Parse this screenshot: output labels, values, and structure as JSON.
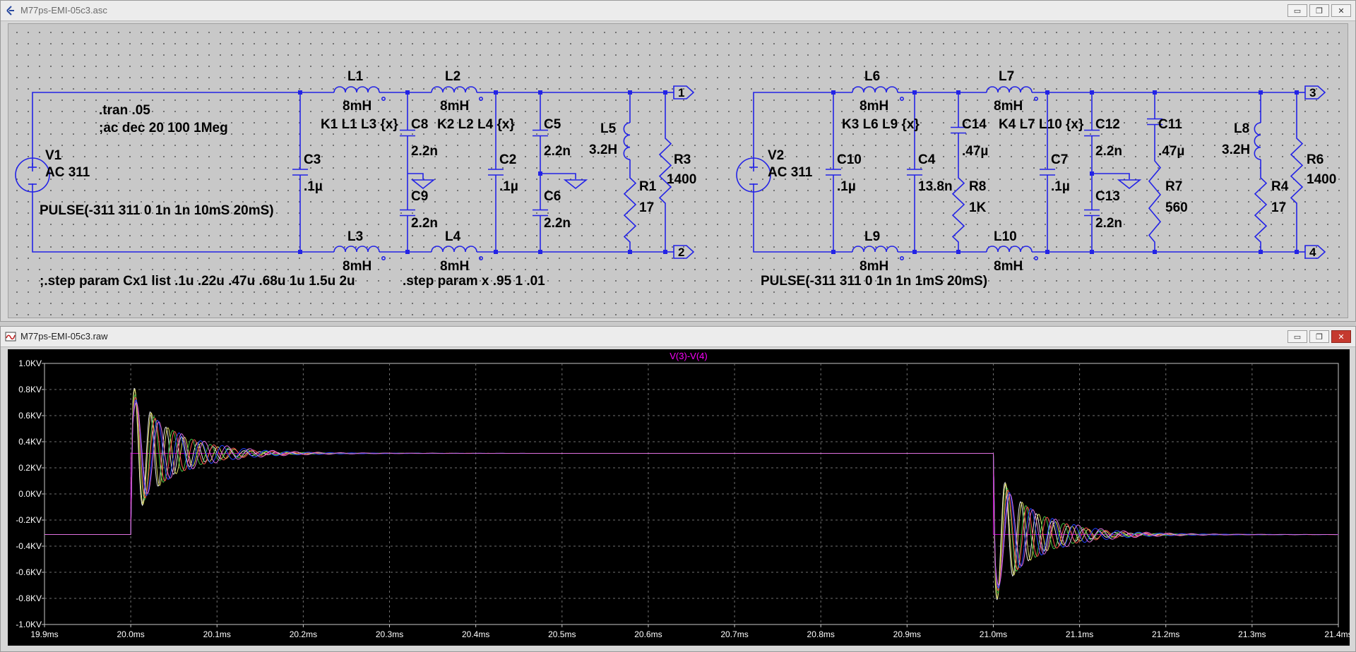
{
  "schematic_window": {
    "title": "M77ps-EMI-05c3.asc",
    "buttons": {
      "minimize": "▭",
      "restore": "❐",
      "close": "✕"
    }
  },
  "plot_window": {
    "title": "M77ps-EMI-05c3.raw",
    "buttons": {
      "minimize": "▭",
      "restore": "❐",
      "close": "✕"
    }
  },
  "schematic": {
    "directives": {
      "tran": ".tran .05",
      "ac": ";ac dec 20 100 1Meg",
      "step1": ";.step param Cx1 list .1u .22u .47u .68u 1u 1.5u 2u",
      "step2": ".step param x .95 1 .01",
      "pulse1": "PULSE(-311 311 0 1n 1n 10mS 20mS)",
      "pulse2": "PULSE(-311 311 0 1n 1n 1mS 20mS)"
    },
    "sources": {
      "v1": {
        "name": "V1",
        "value": "AC 311"
      },
      "v2": {
        "name": "V2",
        "value": "AC 311"
      }
    },
    "inductors": {
      "l1": {
        "name": "L1",
        "value": "8mH"
      },
      "l2": {
        "name": "L2",
        "value": "8mH"
      },
      "l3": {
        "name": "L3",
        "value": "8mH"
      },
      "l4": {
        "name": "L4",
        "value": "8mH"
      },
      "l5": {
        "name": "L5",
        "value": "3.2H"
      },
      "l6": {
        "name": "L6",
        "value": "8mH"
      },
      "l7": {
        "name": "L7",
        "value": "8mH"
      },
      "l8": {
        "name": "L8",
        "value": "3.2H"
      },
      "l9": {
        "name": "L9",
        "value": "8mH"
      },
      "l10": {
        "name": "L10",
        "value": "8mH"
      }
    },
    "couplings": {
      "k1": "K1 L1 L3 {x}",
      "k2": "K2 L2 L4 {x}",
      "k3": "K3 L6 L9 {x}",
      "k4": "K4 L7 L10 {x}"
    },
    "capacitors": {
      "c2": {
        "name": "C2",
        "value": ".1µ"
      },
      "c3": {
        "name": "C3",
        "value": ".1µ"
      },
      "c4": {
        "name": "C4",
        "value": "13.8n"
      },
      "c5": {
        "name": "C5",
        "value": "2.2n"
      },
      "c6": {
        "name": "C6",
        "value": "2.2n"
      },
      "c7": {
        "name": "C7",
        "value": ".1µ"
      },
      "c8": {
        "name": "C8",
        "value": "2.2n"
      },
      "c9": {
        "name": "C9",
        "value": "2.2n"
      },
      "c10": {
        "name": "C10",
        "value": ".1µ"
      },
      "c11": {
        "name": "C11",
        "value": ".47µ"
      },
      "c12": {
        "name": "C12",
        "value": "2.2n"
      },
      "c13": {
        "name": "C13",
        "value": "2.2n"
      },
      "c14": {
        "name": "C14",
        "value": ".47µ"
      }
    },
    "resistors": {
      "r1": {
        "name": "R1",
        "value": "17"
      },
      "r3": {
        "name": "R3",
        "value": "1400"
      },
      "r4": {
        "name": "R4",
        "value": "17"
      },
      "r6": {
        "name": "R6",
        "value": "1400"
      },
      "r7": {
        "name": "R7",
        "value": "560"
      },
      "r8": {
        "name": "R8",
        "value": "1K"
      }
    },
    "ports": {
      "p1": "1",
      "p2": "2",
      "p3": "3",
      "p4": "4"
    }
  },
  "chart_data": {
    "type": "line",
    "title": "V(3)-V(4)",
    "x_tick_labels": [
      "19.9ms",
      "20.0ms",
      "20.1ms",
      "20.2ms",
      "20.3ms",
      "20.4ms",
      "20.5ms",
      "20.6ms",
      "20.7ms",
      "20.8ms",
      "20.9ms",
      "21.0ms",
      "21.1ms",
      "21.2ms",
      "21.3ms",
      "21.4ms"
    ],
    "y_tick_labels": [
      "1.0KV",
      "0.8KV",
      "0.6KV",
      "0.4KV",
      "0.2KV",
      "0.0KV",
      "-0.2KV",
      "-0.4KV",
      "-0.6KV",
      "-0.8KV",
      "-1.0KV"
    ],
    "xlim": [
      19.9,
      21.4
    ],
    "ylim": [
      -1.0,
      1.0
    ],
    "x_unit": "ms",
    "y_unit": "KV",
    "grid": true,
    "input_step": {
      "color": "#c000c0",
      "points": [
        [
          19.9,
          -0.311
        ],
        [
          20.0,
          -0.311
        ],
        [
          20.0,
          0.311
        ],
        [
          21.0,
          0.311
        ],
        [
          21.0,
          -0.311
        ],
        [
          21.4,
          -0.311
        ]
      ]
    },
    "series": [
      {
        "color": "#e8e8e8",
        "peak": 0.81,
        "freq_khz": 55,
        "tau_ms": 0.04
      },
      {
        "color": "#e0e060",
        "peak": 0.8,
        "freq_khz": 52,
        "tau_ms": 0.042
      },
      {
        "color": "#40c040",
        "peak": 0.76,
        "freq_khz": 46,
        "tau_ms": 0.046
      },
      {
        "color": "#ff5050",
        "peak": 0.74,
        "freq_khz": 44,
        "tau_ms": 0.048
      },
      {
        "color": "#2040ff",
        "peak": 0.72,
        "freq_khz": 40,
        "tau_ms": 0.052
      },
      {
        "color": "#e070e0",
        "peak": 0.7,
        "freq_khz": 38,
        "tau_ms": 0.055
      }
    ]
  }
}
